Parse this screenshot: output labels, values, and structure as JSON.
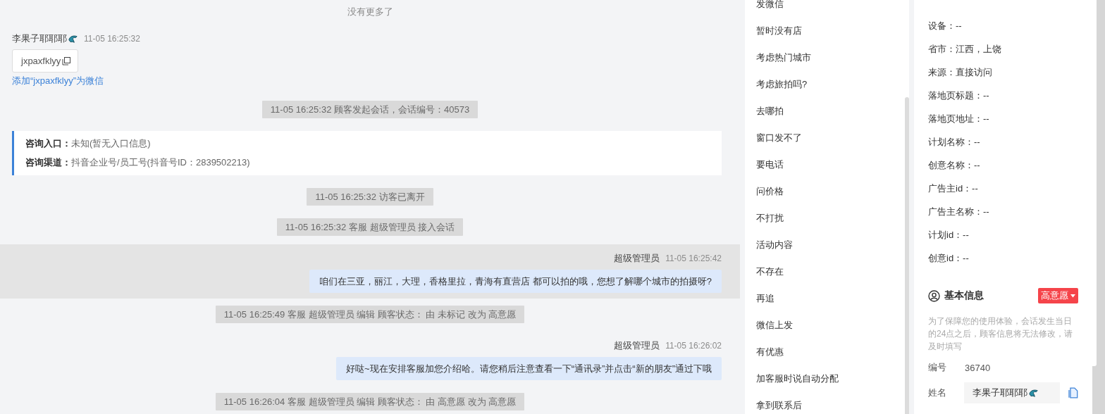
{
  "chat": {
    "no_more": "没有更多了",
    "messages": [
      {
        "kind": "customer",
        "name": "李果子耶耶耶",
        "time": "11-05 16:25:32",
        "card": "jxpaxfklyy",
        "link": "添加“jxpaxfklyy”为微信"
      },
      {
        "kind": "system",
        "text": "11-05 16:25:32 顾客发起会话，会话编号：40573"
      },
      {
        "kind": "entry",
        "lines": [
          {
            "label": "咨询入口：",
            "value": "未知(暂无入口信息)"
          },
          {
            "label": "咨询渠道：",
            "value": "抖音企业号/员工号(抖音号ID：2839502213)"
          }
        ]
      },
      {
        "kind": "system",
        "text": "11-05 16:25:32 访客已离开"
      },
      {
        "kind": "system",
        "text": "11-05 16:25:32 客服 超级管理员 接入会话"
      },
      {
        "kind": "agent",
        "name": "超级管理员",
        "time": "11-05 16:25:42",
        "text": "咱们在三亚，丽江，大理，香格里拉，青海有直营店 都可以拍的哦，您想了解哪个城市的拍摄呀?",
        "hovered": true
      },
      {
        "kind": "system",
        "text": "11-05 16:25:49 客服 超级管理员 编辑 顾客状态： 由 未标记 改为 高意愿"
      },
      {
        "kind": "agent",
        "name": "超级管理员",
        "time": "11-05 16:26:02",
        "text": "好哒~现在安排客服加您介绍哈。请您稍后注意查看一下“通讯录”并点击“新的朋友”通过下哦",
        "hovered": false
      },
      {
        "kind": "system",
        "text": "11-05 16:26:04 客服 超级管理员 编辑 顾客状态： 由 高意愿 改为 高意愿"
      }
    ]
  },
  "quick_replies": [
    "发微信",
    "暂时没有店",
    "考虑热门城市",
    "考虑旅拍吗?",
    "去哪拍",
    "窗口发不了",
    "要电话",
    "问价格",
    "不打扰",
    "活动内容",
    "不存在",
    "再追",
    "微信上发",
    "有优惠",
    "加客服时说自动分配",
    "拿到联系后"
  ],
  "visitor_info": [
    "设备：--",
    "省市：江西，上饶",
    "来源：直接访问",
    "落地页标题：--",
    "落地页地址：--",
    "计划名称：--",
    "创意名称：--",
    "广告主id：--",
    "广告主名称：--",
    "计划id：--",
    "创意id：--"
  ],
  "basic_info": {
    "title": "基本信息",
    "intent_tag": "高意愿",
    "note": "为了保障您的使用体验，会话发生当日的24点之后，顾客信息将无法修改，请及时填写",
    "fields": [
      {
        "kind": "text",
        "label": "编号",
        "value": "36740"
      },
      {
        "kind": "input",
        "label": "姓名",
        "value": "李果子耶耶耶"
      }
    ]
  }
}
